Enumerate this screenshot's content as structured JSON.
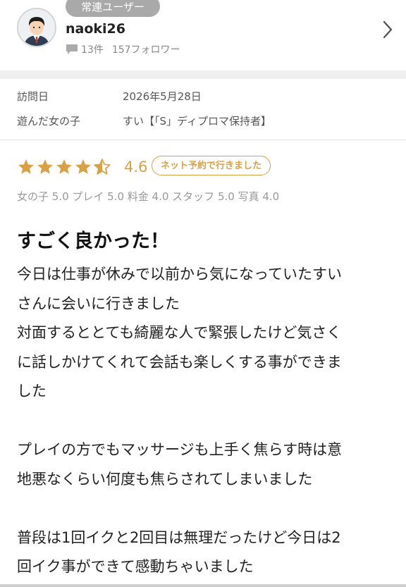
{
  "profile": {
    "badge": "常連ユーザー",
    "username": "naoki26",
    "posts": "13件",
    "followers": "157フォロワー"
  },
  "visit": {
    "date_label": "訪問日",
    "date_value": "2026年5月28日",
    "girl_label": "遊んだ女の子",
    "girl_value": "すい【「S」ディプロマ保持者】"
  },
  "rating": {
    "score": "4.6",
    "stars": 4.6,
    "badge": "ネット予約で行きました",
    "sub_ratings": "女の子 5.0 プレイ 5.0 料金 4.0 スタッフ 5.0 写真 4.0"
  },
  "review": {
    "title": "すごく良かった！",
    "lines": [
      "今日は仕事が休みで以前から気になっていたすい",
      "さんに会いに行きました",
      "対面するととても綺麗な人で緊張したけど気さく",
      "に話しかけてくれて会話も楽しくする事ができま",
      "した",
      "",
      "プレイの方でもマッサージも上手く焦らす時は意",
      "地悪なくらい何度も焦らされてしまいました",
      "",
      "普段は1回イクと2回目は無理だったけど今日は2",
      "回イク事ができて感動ちゃいました"
    ]
  },
  "colors": {
    "accent": "#d9a044",
    "badge_bg": "#a9a9a9",
    "divider": "#efefef"
  }
}
